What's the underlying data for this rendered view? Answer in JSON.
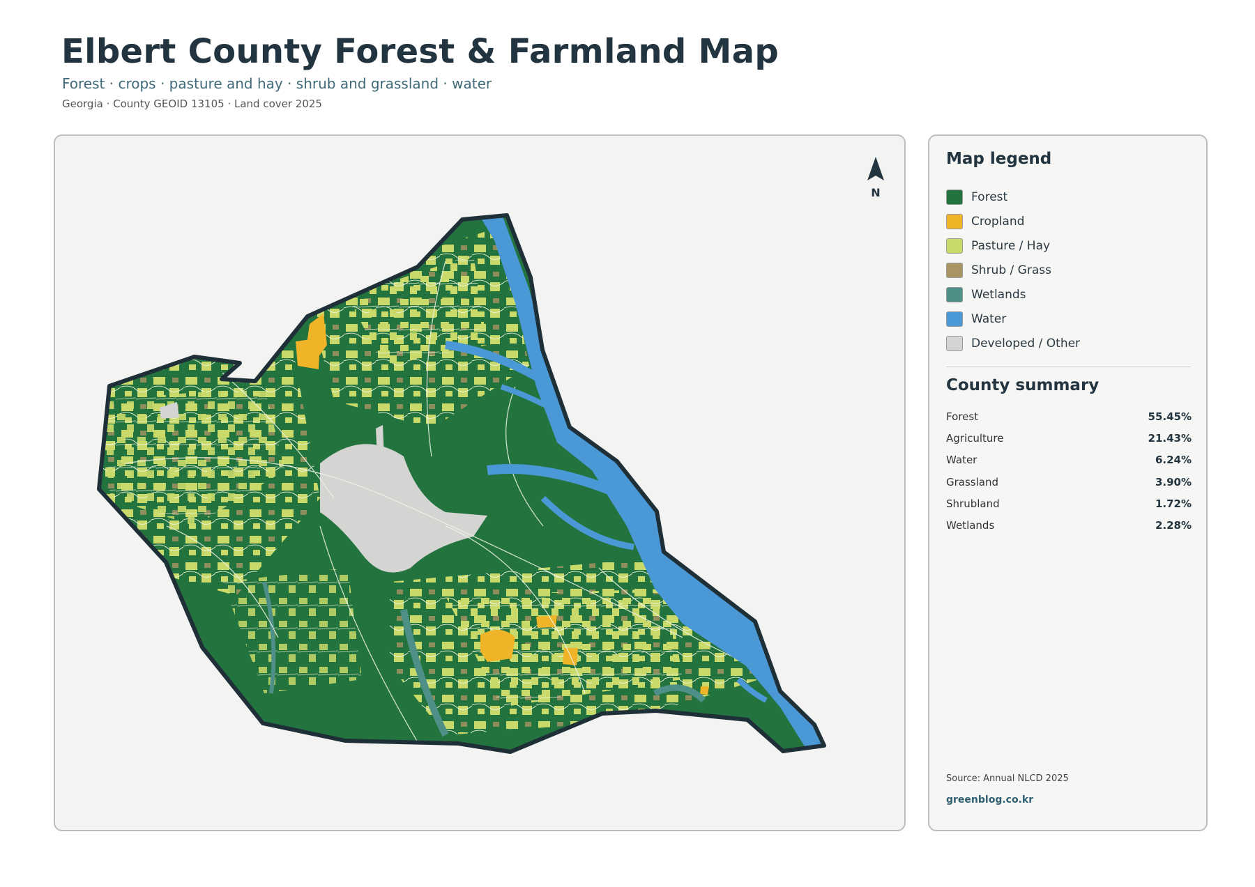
{
  "header": {
    "title": "Elbert County Forest & Farmland Map",
    "subtitle": "Forest · crops · pasture and hay · shrub and grassland · water",
    "meta": "Georgia · County GEOID 13105 · Land cover 2025"
  },
  "map": {
    "north_label": "N",
    "colors": {
      "forest": "#23733e",
      "cropland": "#f0b429",
      "pasture": "#c9da6a",
      "shrub": "#a89563",
      "wetlands": "#4e8f88",
      "water": "#4b98d6",
      "developed": "#d4d4d2",
      "boundary": "#1f2f38",
      "background": "#f3f3f1"
    }
  },
  "legend": {
    "title": "Map legend",
    "items": [
      {
        "label": "Forest",
        "color": "#23733e"
      },
      {
        "label": "Cropland",
        "color": "#f0b429"
      },
      {
        "label": "Pasture / Hay",
        "color": "#c9da6a"
      },
      {
        "label": "Shrub / Grass",
        "color": "#a89563"
      },
      {
        "label": "Wetlands",
        "color": "#4e8f88"
      },
      {
        "label": "Water",
        "color": "#4b98d6"
      },
      {
        "label": "Developed / Other",
        "color": "#d4d4d2"
      }
    ]
  },
  "summary": {
    "title": "County summary",
    "rows": [
      {
        "label": "Forest",
        "value": "55.45%"
      },
      {
        "label": "Agriculture",
        "value": "21.43%"
      },
      {
        "label": "Water",
        "value": "6.24%"
      },
      {
        "label": "Grassland",
        "value": "3.90%"
      },
      {
        "label": "Shrubland",
        "value": "1.72%"
      },
      {
        "label": "Wetlands",
        "value": "2.28%"
      }
    ]
  },
  "footer": {
    "source": "Source: Annual NLCD 2025",
    "site": "greenblog.co.kr"
  }
}
